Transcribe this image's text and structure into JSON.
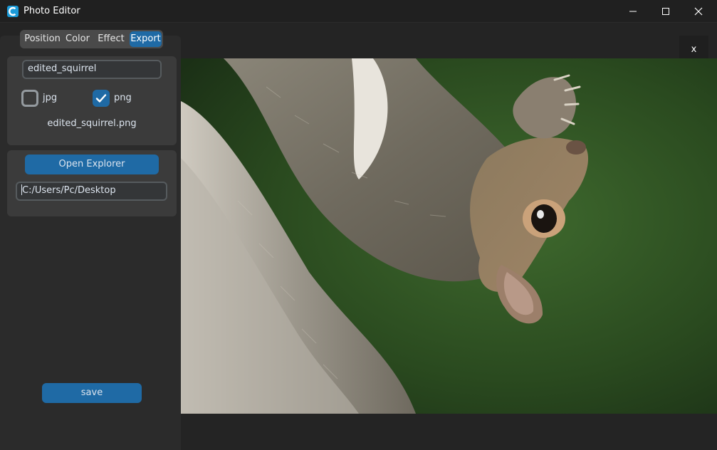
{
  "window": {
    "title": "Photo Editor"
  },
  "tabs": [
    {
      "label": "Position",
      "active": false
    },
    {
      "label": "Color",
      "active": false
    },
    {
      "label": "Effect",
      "active": false
    },
    {
      "label": "Export",
      "active": true
    }
  ],
  "export": {
    "filename_value": "edited_squirrel",
    "format_options": [
      {
        "label": "jpg",
        "checked": false
      },
      {
        "label": "png",
        "checked": true
      }
    ],
    "output_filename": "edited_squirrel.png",
    "open_explorer_label": "Open Explorer",
    "path_value": "C:/Users/Pc/Desktop",
    "save_label": "save"
  },
  "image_panel": {
    "close_label": "x"
  },
  "colors": {
    "accent": "#1f6aa5",
    "window_bg": "#242424",
    "sidebar_bg": "#2b2b2b",
    "frame_bg": "#3b3b3b"
  },
  "icons": {
    "app": "app-logo-icon",
    "minimize": "minimize-icon",
    "maximize": "maximize-icon",
    "close": "close-icon",
    "checkmark": "checkmark-icon"
  }
}
